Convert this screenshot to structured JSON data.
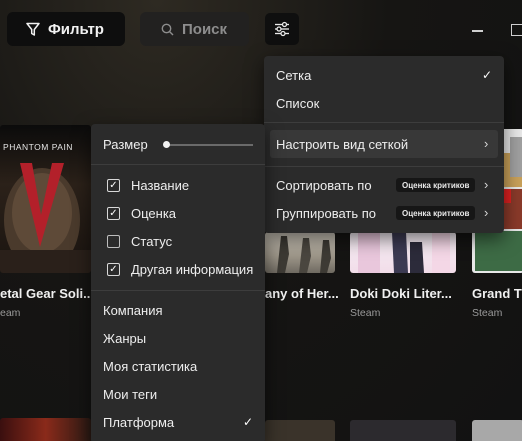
{
  "toolbar": {
    "filter_label": "Фильтр",
    "search_placeholder": "Поиск"
  },
  "view_menu": {
    "grid_label": "Сетка",
    "list_label": "Список",
    "configure_grid_label": "Настроить вид сеткой",
    "sort_label": "Сортировать по",
    "sort_value": "Оценка критиков",
    "group_label": "Группировать по",
    "group_value": "Оценка критиков"
  },
  "grid_settings_menu": {
    "size_label": "Размер",
    "size_value": 0.0,
    "fields": [
      {
        "label": "Название",
        "checked": true
      },
      {
        "label": "Оценка",
        "checked": true
      },
      {
        "label": "Статус",
        "checked": false
      },
      {
        "label": "Другая информация",
        "checked": true
      }
    ],
    "group_options": [
      {
        "label": "Компания",
        "checked": false
      },
      {
        "label": "Жанры",
        "checked": false
      },
      {
        "label": "Моя статистика",
        "checked": false
      },
      {
        "label": "Мои теги",
        "checked": false
      },
      {
        "label": "Платформа",
        "checked": true
      }
    ]
  },
  "games": [
    {
      "title": "etal Gear Soli...",
      "platform": "eam",
      "cover_text": "E PHANTOM PAIN"
    },
    {
      "title": "any of Her...",
      "platform": ""
    },
    {
      "title": "Doki Doki Liter...",
      "platform": "Steam"
    },
    {
      "title": "Grand Th",
      "platform": "Steam"
    }
  ],
  "colors": {
    "menu_bg": "#2b2b2b",
    "menu_hover": "#383838",
    "accent_red": "#b3202a"
  }
}
